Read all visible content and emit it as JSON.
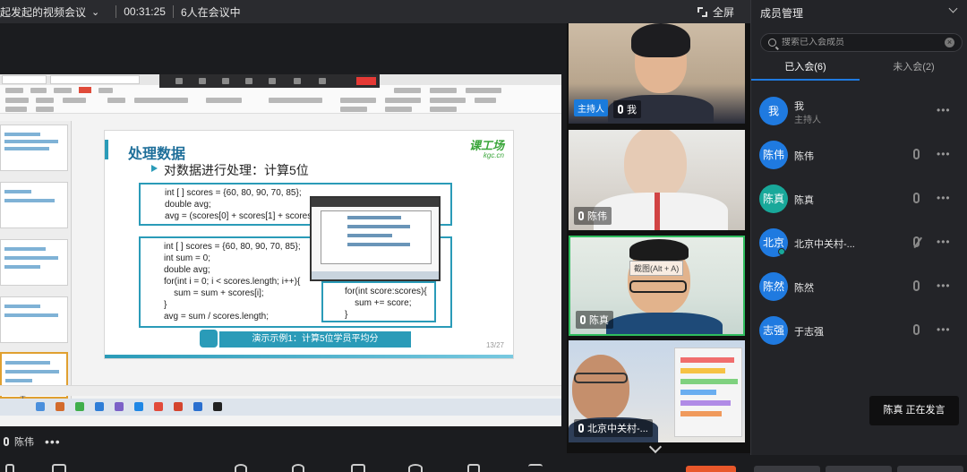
{
  "topbar": {
    "meeting_title": "起发起的视频会议",
    "elapsed": "00:31:25",
    "participants_status": "6人在会议中",
    "fullscreen_label": "全屏"
  },
  "slide": {
    "heading": "处理数据",
    "bullet": "对数据进行处理：计算5位",
    "logo": "课工场",
    "logo_sub": "kgc.cn",
    "code1": "int [ ] scores = {60, 80, 90, 70, 85};\ndouble avg;\navg = (scores[0] + scores[1] + scores",
    "code2": "int [ ] scores = {60, 80, 90, 70, 85};\nint sum = 0;\ndouble avg;\nfor(int i = 0; i < scores.length; i++){\n    sum = sum + scores[i];\n}\navg = sum / scores.length;",
    "code3": "for(int score:scores){\n    sum += score;\n}",
    "demo_button": "演示示例1：计算5位学员平均分",
    "page_number": "13/27"
  },
  "current_speaker": "陈伟",
  "videos": [
    {
      "name": "我",
      "host_badge": "主持人"
    },
    {
      "name": "陈伟"
    },
    {
      "name": "陈真",
      "tooltip": "截图(Alt + A)"
    },
    {
      "name": "北京中关村-..."
    }
  ],
  "panel": {
    "title": "成员管理",
    "search_placeholder": "搜索已入会成员",
    "tab_joined": "已入会(6)",
    "tab_not_joined": "未入会(2)",
    "members": [
      {
        "avatar": "我",
        "name": "我",
        "role": "主持人"
      },
      {
        "avatar": "陈伟",
        "name": "陈伟"
      },
      {
        "avatar": "陈真",
        "name": "陈真"
      },
      {
        "avatar": "北京",
        "name": "北京中关村-..."
      },
      {
        "avatar": "陈然",
        "name": "陈然"
      },
      {
        "avatar": "志强",
        "name": "于志强"
      }
    ]
  },
  "toast": {
    "speaker": "陈真",
    "status": "正在发言"
  },
  "colors": {
    "accent_blue": "#1f7ae0",
    "slide_teal": "#2a9bb8",
    "speaking_green": "#2fbd5e",
    "stop_red": "#e53935"
  }
}
